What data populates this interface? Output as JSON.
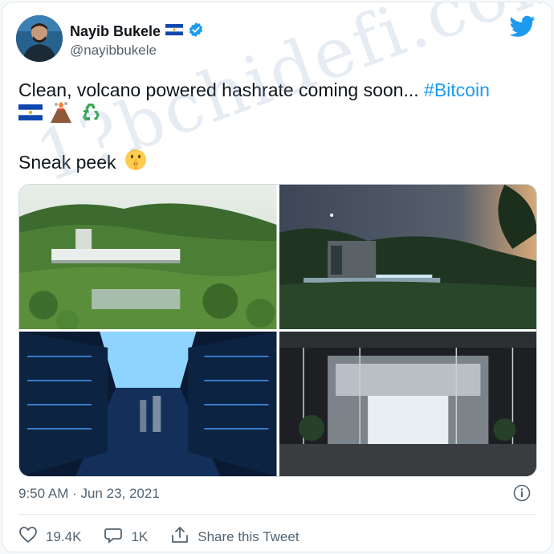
{
  "author": {
    "name": "Nayib Bukele",
    "handle": "@nayibbukele",
    "verified": true
  },
  "tweet": {
    "text": "Clean, volcano powered hashrate coming soon... ",
    "hashtag": "#Bitcoin",
    "emojis": [
      "el-salvador-flag",
      "volcano",
      "recycle"
    ],
    "sneak_text": "Sneak peek",
    "sneak_emoji": "shushing-face"
  },
  "media": [
    {
      "scene": "geothermal-plant-daytime"
    },
    {
      "scene": "geothermal-plant-night"
    },
    {
      "scene": "server-room"
    },
    {
      "scene": "glass-lobby"
    }
  ],
  "timestamp": "9:50 AM · Jun 23, 2021",
  "actions": {
    "likes": "19.4K",
    "replies": "1K",
    "share_label": "Share this Tweet"
  },
  "watermark": "1?bchidefi.com",
  "colors": {
    "accent": "#1d9bf0",
    "text": "#0f1419",
    "muted": "#536471"
  }
}
